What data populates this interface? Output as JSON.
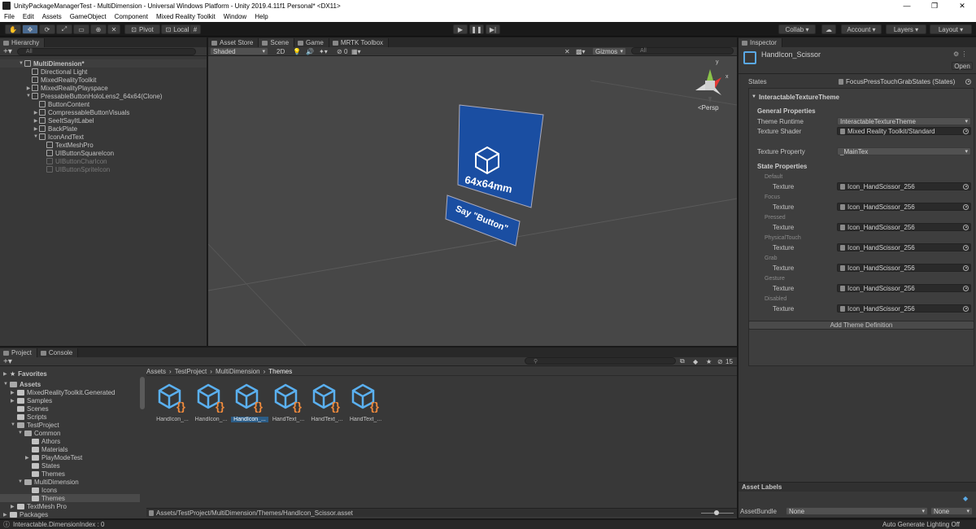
{
  "window": {
    "title": "UnityPackageManagerTest - MultiDimension - Universal Windows Platform - Unity 2019.4.11f1 Personal* <DX11>",
    "controls": [
      "—",
      "❐",
      "✕"
    ]
  },
  "menu": [
    "File",
    "Edit",
    "Assets",
    "GameObject",
    "Component",
    "Mixed Reality Toolkit",
    "Window",
    "Help"
  ],
  "toolbar": {
    "pivot": "Pivot",
    "local": "Local",
    "collab": "Collab",
    "account": "Account",
    "layers": "Layers",
    "layout": "Layout"
  },
  "hierarchy": {
    "tab": "Hierarchy",
    "search_placeholder": "All",
    "items": [
      {
        "label": "MultiDimension*",
        "depth": 0,
        "arrow": "▼",
        "dim": false,
        "scene": true
      },
      {
        "label": "Directional Light",
        "depth": 1,
        "arrow": "",
        "dim": false
      },
      {
        "label": "MixedRealityToolkit",
        "depth": 1,
        "arrow": "",
        "dim": false
      },
      {
        "label": "MixedRealityPlayspace",
        "depth": 1,
        "arrow": "▶",
        "dim": false
      },
      {
        "label": "PressableButtonHoloLens2_64x64(Clone)",
        "depth": 1,
        "arrow": "▼",
        "dim": false
      },
      {
        "label": "ButtonContent",
        "depth": 2,
        "arrow": "",
        "dim": false
      },
      {
        "label": "CompressableButtonVisuals",
        "depth": 2,
        "arrow": "▶",
        "dim": false
      },
      {
        "label": "SeeItSayItLabel",
        "depth": 2,
        "arrow": "▶",
        "dim": false
      },
      {
        "label": "BackPlate",
        "depth": 2,
        "arrow": "▶",
        "dim": false
      },
      {
        "label": "IconAndText",
        "depth": 2,
        "arrow": "▼",
        "dim": false
      },
      {
        "label": "TextMeshPro",
        "depth": 3,
        "arrow": "",
        "dim": false
      },
      {
        "label": "UIButtonSquareIcon",
        "depth": 3,
        "arrow": "",
        "dim": false
      },
      {
        "label": "UIButtonCharIcon",
        "depth": 3,
        "arrow": "",
        "dim": true
      },
      {
        "label": "UIButtonSpriteIcon",
        "depth": 3,
        "arrow": "",
        "dim": true
      }
    ]
  },
  "scene_view": {
    "tabs": [
      "Asset Store",
      "Scene",
      "Game",
      "MRTK Toolbox"
    ],
    "active_tab": "Scene",
    "shading": "Shaded",
    "mode_2d": "2D",
    "hidden_count": "0",
    "gizmos": "Gizmos",
    "search_placeholder": "All",
    "persp": "Persp",
    "button_text": "64x64mm",
    "label_text": "Say \"Button\"",
    "gizmo_axes": {
      "y": "y",
      "x": "x"
    }
  },
  "inspector": {
    "tab": "Inspector",
    "object_name": "HandIcon_Scissor",
    "open_label": "Open",
    "states_label": "States",
    "states_value": "FocusPressTouchGrabStates (States)",
    "component": "InteractableTextureTheme",
    "general_properties": "General Properties",
    "theme_runtime_label": "Theme Runtime",
    "theme_runtime_value": "InteractableTextureTheme",
    "texture_shader_label": "Texture Shader",
    "texture_shader_value": "Mixed Reality Toolkit/Standard",
    "texture_property_label": "Texture Property",
    "texture_property_value": "_MainTex",
    "state_properties": "State Properties",
    "states": [
      {
        "name": "Default",
        "field": "Texture",
        "value": "Icon_HandScissor_256"
      },
      {
        "name": "Focus",
        "field": "Texture",
        "value": "Icon_HandScissor_256"
      },
      {
        "name": "Pressed",
        "field": "Texture",
        "value": "Icon_HandScissor_256"
      },
      {
        "name": "PhysicalTouch",
        "field": "Texture",
        "value": "Icon_HandScissor_256"
      },
      {
        "name": "Grab",
        "field": "Texture",
        "value": "Icon_HandScissor_256"
      },
      {
        "name": "Gesture",
        "field": "Texture",
        "value": "Icon_HandScissor_256"
      },
      {
        "name": "Disabled",
        "field": "Texture",
        "value": "Icon_HandScissor_256"
      }
    ],
    "add_theme": "Add Theme Definition",
    "asset_labels": "Asset Labels",
    "asset_bundle_label": "AssetBundle",
    "asset_bundle_value": "None",
    "asset_bundle_variant": "None"
  },
  "project": {
    "tabs": [
      "Project",
      "Console"
    ],
    "hidden_count": "15",
    "breadcrumb": [
      "Assets",
      "TestProject",
      "MultiDimension",
      "Themes"
    ],
    "tree": [
      {
        "label": "Favorites",
        "depth": 0,
        "arrow": "▶",
        "star": true
      },
      {
        "label": "Assets",
        "depth": 0,
        "arrow": "▼",
        "bold": true
      },
      {
        "label": "MixedRealityToolkit.Generated",
        "depth": 1,
        "arrow": "▶"
      },
      {
        "label": "Samples",
        "depth": 1,
        "arrow": "▶"
      },
      {
        "label": "Scenes",
        "depth": 1,
        "arrow": ""
      },
      {
        "label": "Scripts",
        "depth": 1,
        "arrow": ""
      },
      {
        "label": "TestProject",
        "depth": 1,
        "arrow": "▼"
      },
      {
        "label": "Common",
        "depth": 2,
        "arrow": "▼"
      },
      {
        "label": "Athors",
        "depth": 3,
        "arrow": ""
      },
      {
        "label": "Materials",
        "depth": 3,
        "arrow": ""
      },
      {
        "label": "PlayModeTest",
        "depth": 3,
        "arrow": "▶"
      },
      {
        "label": "States",
        "depth": 3,
        "arrow": ""
      },
      {
        "label": "Themes",
        "depth": 3,
        "arrow": ""
      },
      {
        "label": "MultiDimension",
        "depth": 2,
        "arrow": "▼"
      },
      {
        "label": "Icons",
        "depth": 3,
        "arrow": ""
      },
      {
        "label": "Themes",
        "depth": 3,
        "arrow": "",
        "selected": true
      },
      {
        "label": "TextMesh Pro",
        "depth": 1,
        "arrow": "▶"
      },
      {
        "label": "Packages",
        "depth": 0,
        "arrow": "▶"
      }
    ],
    "assets": [
      {
        "label": "HandIcon_...",
        "selected": false
      },
      {
        "label": "HandIcon_...",
        "selected": false
      },
      {
        "label": "HandIcon_...",
        "selected": true
      },
      {
        "label": "HandText_...",
        "selected": false
      },
      {
        "label": "HandText_...",
        "selected": false
      },
      {
        "label": "HandText_...",
        "selected": false
      }
    ],
    "path": "Assets/TestProject/MultiDimension/Themes/HandIcon_Scissor.asset"
  },
  "status": {
    "left": "Interactable.DimensionIndex : 0",
    "right": "Auto Generate Lighting Off"
  }
}
